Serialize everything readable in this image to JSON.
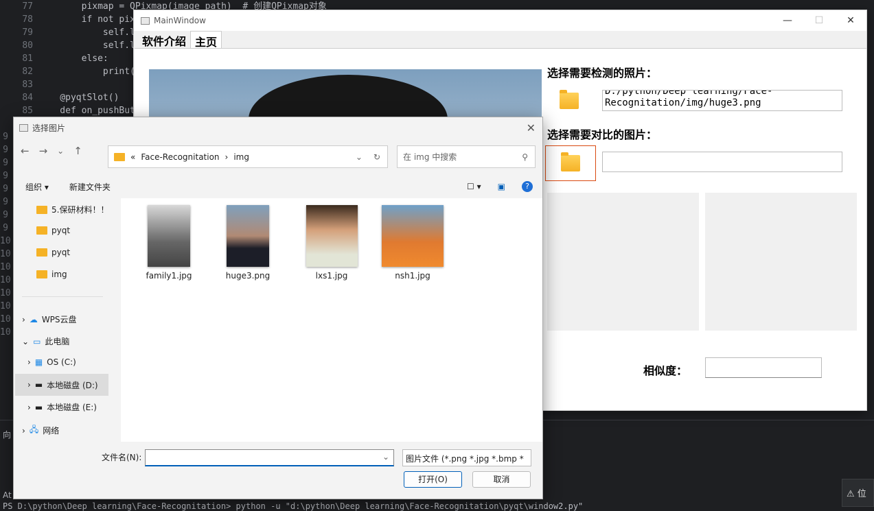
{
  "editor": {
    "lines": [
      {
        "n": "77",
        "html": "        pixmap = QPixmap(image_path)  # 创建QPixmap对象"
      },
      {
        "n": "78",
        "html": "        if not pix"
      },
      {
        "n": "79",
        "html": "            self.l"
      },
      {
        "n": "80",
        "html": "            self.l"
      },
      {
        "n": "81",
        "html": "        else:"
      },
      {
        "n": "82",
        "html": "            print("
      },
      {
        "n": "83",
        "html": ""
      },
      {
        "n": "84",
        "html": "    @pyqtSlot()"
      },
      {
        "n": "85",
        "html": "    def on_pushBut"
      }
    ],
    "gutter_more": [
      "9",
      "9",
      "9",
      "9",
      "9",
      "9",
      "9",
      "9",
      "10",
      "10",
      "10",
      "10",
      "10",
      "10",
      "10",
      "10"
    ],
    "terminal": {
      "line1": "向",
      "line2": "At",
      "line3": "PS D:\\python\\Deep learning\\Face-Recognitation> python -u \"d:\\python\\Deep learning\\Face-Recognitation\\pyqt\\window2.py\""
    }
  },
  "mainwin": {
    "title": "MainWindow",
    "tabs": [
      "软件介绍",
      "主页"
    ],
    "label_detect": "选择需要检测的照片：",
    "path_text": "D:/python/Deep learning/Face-Recognitation/img/huge3.png",
    "label_compare": "选择需要对比的图片：",
    "label_similarity": "相似度："
  },
  "dialog": {
    "title": "选择图片",
    "breadcrumb": [
      "«",
      "Face-Recognitation",
      "›",
      "img"
    ],
    "search_placeholder": "在 img 中搜索",
    "toolbar": {
      "organize": "组织 ▾",
      "new_folder": "新建文件夹"
    },
    "nav": [
      "5.保研材料！！",
      "pyqt",
      "pyqt",
      "img",
      "WPS云盘",
      "此电脑",
      "OS (C:)",
      "本地磁盘 (D:)",
      "本地磁盘 (E:)",
      "网络"
    ],
    "files": [
      {
        "name": "family1.jpg"
      },
      {
        "name": "huge3.png"
      },
      {
        "name": "lxs1.jpg"
      },
      {
        "name": "nsh1.jpg"
      }
    ],
    "filename_label": "文件名(N):",
    "filetype": "图片文件 (*.png *.jpg *.bmp *",
    "open": "打开(O)",
    "cancel": "取消"
  },
  "toast": {
    "text": "⚠ 位"
  }
}
